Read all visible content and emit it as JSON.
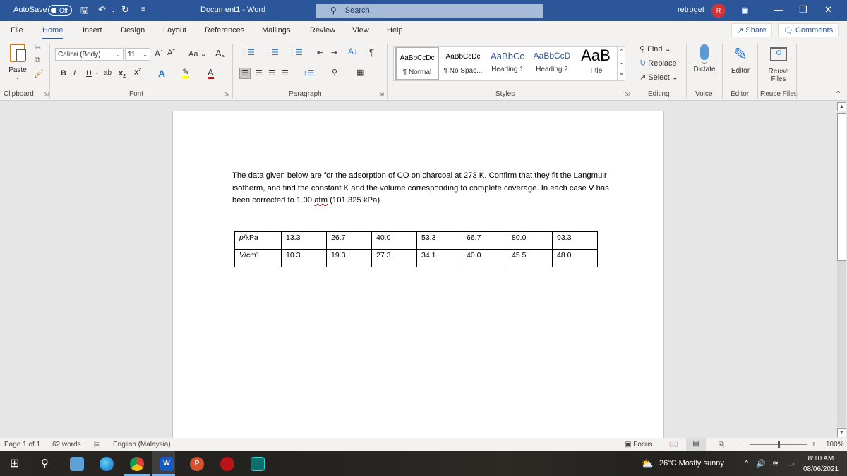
{
  "titlebar": {
    "autosave_label": "AutoSave",
    "autosave_state": "Off",
    "doc_title": "Document1  -  Word",
    "search_placeholder": "Search",
    "user_name": "retroget",
    "avatar_initial": "R",
    "icons": [
      "save-icon",
      "undo-icon",
      "redo-icon",
      "customize-qat-icon",
      "ribbon-display-icon",
      "minimize-icon",
      "restore-icon",
      "close-icon"
    ]
  },
  "menu": {
    "tabs": [
      "File",
      "Home",
      "Insert",
      "Design",
      "Layout",
      "References",
      "Mailings",
      "Review",
      "View",
      "Help"
    ],
    "active_tab": "Home",
    "share_label": "Share",
    "comments_label": "Comments"
  },
  "ribbon": {
    "clipboard": {
      "paste_label": "Paste",
      "group_label": "Clipboard"
    },
    "font": {
      "font_name": "Calibri (Body)",
      "font_size": "11",
      "change_case": "Aa",
      "group_label": "Font",
      "highlight_color": "#ffff00",
      "font_color": "#ff0000"
    },
    "paragraph": {
      "group_label": "Paragraph"
    },
    "styles": {
      "items": [
        {
          "preview": "AaBbCcDc",
          "name": "¶ Normal"
        },
        {
          "preview": "AaBbCcDc",
          "name": "¶ No Spac..."
        },
        {
          "preview": "AaBbCc",
          "name": "Heading 1"
        },
        {
          "preview": "AaBbCcD",
          "name": "Heading 2"
        },
        {
          "preview": "AaB",
          "name": "Title"
        }
      ],
      "selected": "Normal",
      "group_label": "Styles"
    },
    "editing": {
      "find": "Find",
      "replace": "Replace",
      "select": "Select",
      "group_label": "Editing"
    },
    "voice": {
      "dictate": "Dictate",
      "group_label": "Voice"
    },
    "editor": {
      "label": "Editor",
      "group_label": "Editor"
    },
    "reuse": {
      "label1": "Reuse",
      "label2": "Files",
      "group_label": "Reuse Files"
    }
  },
  "document": {
    "paragraph_before": "The data given below are for the adsorption of CO on charcoal at 273 K. Confirm that they fit the Langmuir isotherm, and find the constant K and the volume corresponding to complete coverage. In each case V has been corrected to 1.00 ",
    "misspelled": "atm",
    "paragraph_after": " (101.325 kPa)",
    "table": {
      "rows": [
        {
          "header_var": "p",
          "header_unit": "/kPa",
          "values": [
            "13.3",
            "26.7",
            "40.0",
            "53.3",
            "66.7",
            "80.0",
            "93.3"
          ]
        },
        {
          "header_var": "V",
          "header_unit": "/cm³",
          "values": [
            "10.3",
            "19.3",
            "27.3",
            "34.1",
            "40.0",
            "45.5",
            "48.0"
          ]
        }
      ]
    }
  },
  "statusbar": {
    "page": "Page 1 of 1",
    "words": "62 words",
    "language": "English (Malaysia)",
    "focus": "Focus",
    "zoom": "100%",
    "zoom_percent": 100
  },
  "taskbar": {
    "weather": "26°C  Mostly sunny",
    "time": "8:10 AM",
    "date": "08/06/2021",
    "apps": [
      "start",
      "search",
      "news",
      "edge",
      "chrome",
      "word",
      "powerpoint",
      "app-red",
      "app-teal"
    ]
  }
}
